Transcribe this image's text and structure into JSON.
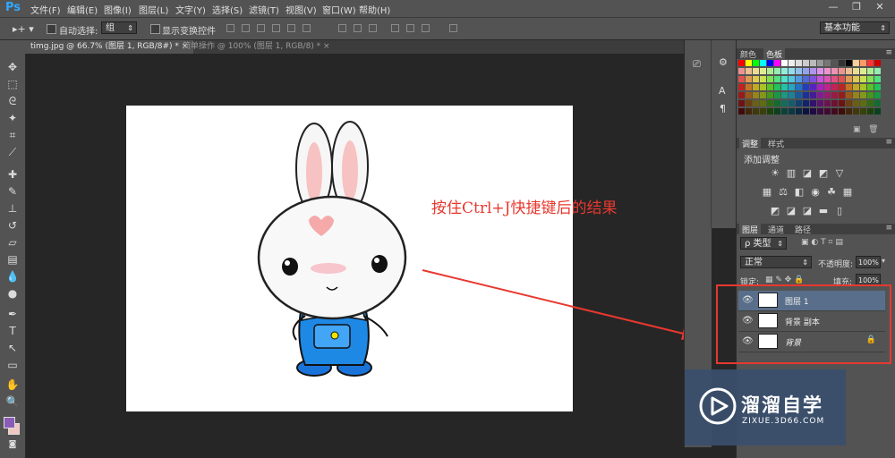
{
  "app": {
    "logo": "Ps"
  },
  "menu": [
    "文件(F)",
    "编辑(E)",
    "图像(I)",
    "图层(L)",
    "文字(Y)",
    "选择(S)",
    "滤镜(T)",
    "视图(V)",
    "窗口(W)",
    "帮助(H)"
  ],
  "window_controls": [
    "—",
    "❐",
    "✕"
  ],
  "options": {
    "auto_select_label": "自动选择:",
    "auto_select_value": "组",
    "show_transform_label": "显示变换控件",
    "workspace": "基本功能"
  },
  "tabs": [
    {
      "label": "timg.jpg @ 66.7% (图层 1, RGB/8#) *",
      "active": true
    },
    {
      "label": "简单操作 @ 100% (图层 1, RGB/8) *",
      "active": false
    }
  ],
  "tools": [
    "move-tool",
    "marquee-tool",
    "lasso-tool",
    "magic-wand-tool",
    "crop-tool",
    "eyedropper-tool",
    "healing-tool",
    "brush-tool",
    "clone-stamp-tool",
    "history-brush-tool",
    "eraser-tool",
    "gradient-tool",
    "blur-tool",
    "dodge-tool",
    "pen-tool",
    "type-tool",
    "path-select-tool",
    "rectangle-tool",
    "hand-tool",
    "zoom-tool"
  ],
  "colors": {
    "foreground": "#8b5bb8",
    "background": "#f2c7c1",
    "accent_red": "#e8382f"
  },
  "swatches_panel": {
    "tabs": [
      "颜色",
      "色板"
    ]
  },
  "adjustments_panel": {
    "tabs": [
      "调整",
      "样式"
    ],
    "title": "添加调整"
  },
  "layers_panel": {
    "tabs": [
      "图层",
      "通道",
      "路径"
    ],
    "filter_label": "ρ 类型",
    "blend_mode": "正常",
    "opacity_label": "不透明度:",
    "opacity_value": "100%",
    "lock_label": "锁定:",
    "fill_label": "填充:",
    "fill_value": "100%",
    "layers": [
      {
        "name": "图层 1",
        "selected": true,
        "locked": false
      },
      {
        "name": "背景 副本",
        "selected": false,
        "locked": false
      },
      {
        "name": "背景",
        "selected": false,
        "locked": true
      }
    ]
  },
  "annotation": {
    "text": "按住Ctrl+J快捷键后的结果"
  },
  "watermark": {
    "title": "溜溜自学",
    "subtitle": "ZIXUE.3D66.COM"
  }
}
